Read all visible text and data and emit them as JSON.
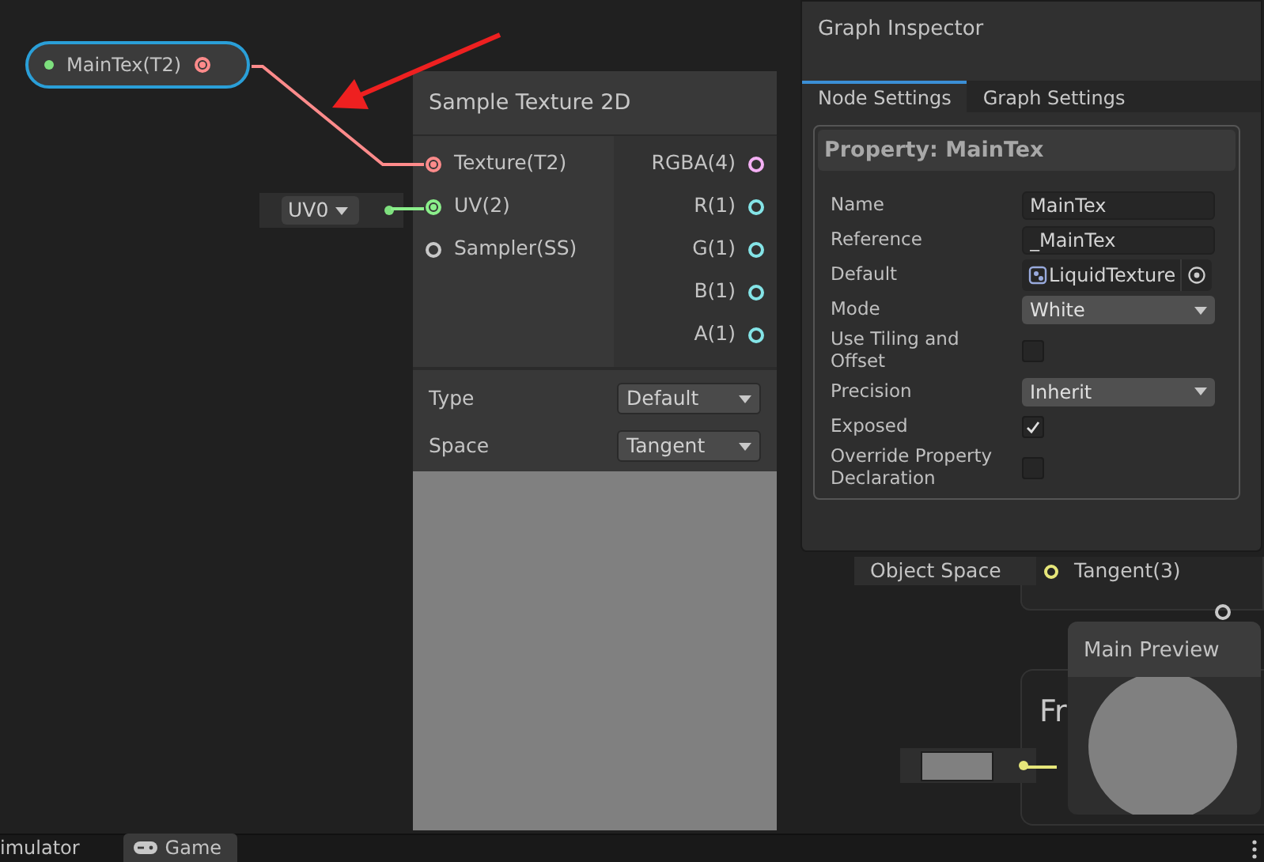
{
  "property_node": {
    "label": "MainTex(T2)",
    "selected": true
  },
  "sample_node": {
    "title": "Sample Texture 2D",
    "inputs": [
      {
        "label": "Texture(T2)",
        "color": "#ff8b8b",
        "connected": true
      },
      {
        "label": "UV(2)",
        "color": "#8bef8b",
        "connected": true
      },
      {
        "label": "Sampler(SS)",
        "color": "#c8c8c8",
        "connected": false
      }
    ],
    "outputs": [
      {
        "label": "RGBA(4)",
        "color": "#f4b0f4"
      },
      {
        "label": "R(1)",
        "color": "#84e4e7"
      },
      {
        "label": "G(1)",
        "color": "#84e4e7"
      },
      {
        "label": "B(1)",
        "color": "#84e4e7"
      },
      {
        "label": "A(1)",
        "color": "#84e4e7"
      }
    ],
    "settings": [
      {
        "label": "Type",
        "value": "Default"
      },
      {
        "label": "Space",
        "value": "Tangent"
      }
    ]
  },
  "uv_node": {
    "value": "UV0"
  },
  "background_nodes": {
    "dropdown": "Object Space",
    "port_label": "Tangent(3)",
    "title": "Fr"
  },
  "inspector": {
    "title": "Graph Inspector",
    "tabs": [
      {
        "label": "Node Settings",
        "selected": true
      },
      {
        "label": "Graph Settings",
        "selected": false
      }
    ],
    "header": "Property: MainTex",
    "fields": [
      {
        "kind": "text",
        "label": "Name",
        "value": "MainTex"
      },
      {
        "kind": "text",
        "label": "Reference",
        "value": "_MainTex"
      },
      {
        "kind": "object",
        "label": "Default",
        "value": "LiquidTexture"
      },
      {
        "kind": "dropdown",
        "label": "Mode",
        "value": "White"
      },
      {
        "kind": "checkbox",
        "label": "Use Tiling and Offset",
        "checked": false
      },
      {
        "kind": "dropdown",
        "label": "Precision",
        "value": "Inherit"
      },
      {
        "kind": "checkbox",
        "label": "Exposed",
        "checked": true
      },
      {
        "kind": "checkbox",
        "label": "Override Property Declaration",
        "checked": false
      }
    ]
  },
  "main_preview": {
    "title": "Main Preview"
  },
  "bottom_tabs": [
    {
      "label": "imulator",
      "selected": false,
      "kind": "plain"
    },
    {
      "label": "Game",
      "selected": true,
      "kind": "game"
    }
  ]
}
